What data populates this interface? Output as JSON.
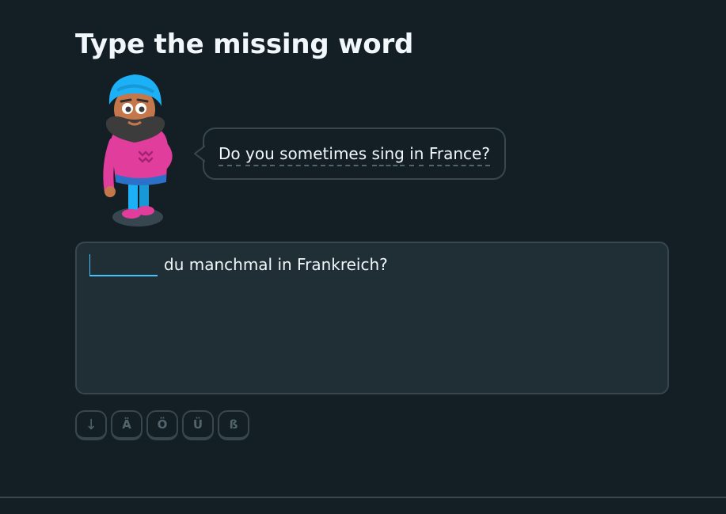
{
  "exercise": {
    "title": "Type the missing word",
    "prompt_words": [
      "Do",
      "you",
      "sometimes",
      "sing",
      "in",
      "France?"
    ],
    "blank_value": "",
    "sentence_rest": "du manchmal in Frankreich?"
  },
  "keyboard": {
    "keys": [
      "↓",
      "Ä",
      "Ö",
      "Ü",
      "ß"
    ]
  },
  "colors": {
    "background": "#131f24",
    "border": "#37464f",
    "input_accent": "#49c0f8",
    "character_turban": "#1cb0f6",
    "character_sweater": "#e13d9c"
  }
}
